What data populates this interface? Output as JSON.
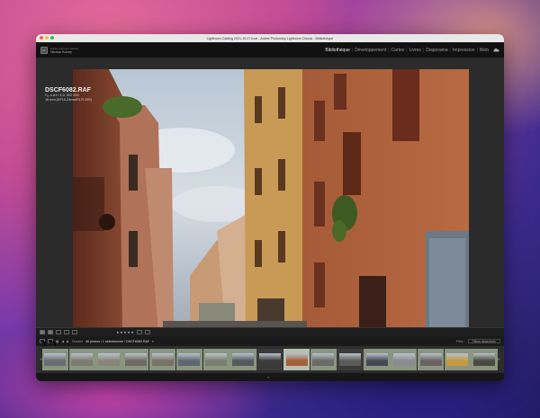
{
  "window": {
    "title": "Lightroom Catalog 2021-10-27.lrcat - Adobe Photoshop Lightroom Classic - Bibliothèque"
  },
  "brand": {
    "top": "Adobe Lightroom Classic",
    "user": "Nicolas Hoizey",
    "logo": "Lr"
  },
  "modules": [
    {
      "label": "Bibliothèque",
      "active": true
    },
    {
      "label": "Développement",
      "active": false
    },
    {
      "label": "Cartes",
      "active": false
    },
    {
      "label": "Livres",
      "active": false
    },
    {
      "label": "Diaporama",
      "active": false
    },
    {
      "label": "Impression",
      "active": false
    },
    {
      "label": "Web",
      "active": false
    }
  ],
  "photo_info": {
    "filename": "DSCF6082.RAF",
    "exposure": "¹⁄₆₀ s à f / 4,0, ISO 200",
    "lens": "16 mm (XF10-24mmF4 R OIS)"
  },
  "toolbar": {
    "stars": "★★★★★"
  },
  "filmnav": {
    "page_left": "1",
    "page_right": "2",
    "source": "Dossier",
    "summary": "46 photos / 1 sélectionnée / DSCF6082.RAF",
    "filter_label": "Filtre :",
    "filter_value": "Filtres désactivés"
  },
  "filmstrip": {
    "thumbs": [
      {
        "num": "1"
      },
      {
        "num": "2"
      },
      {
        "num": "3"
      },
      {
        "num": "4"
      },
      {
        "num": "5"
      },
      {
        "num": "6"
      },
      {
        "num": "7"
      },
      {
        "num": "8"
      },
      {
        "num": "9"
      },
      {
        "num": "10"
      },
      {
        "num": "11"
      },
      {
        "num": "12"
      },
      {
        "num": "13"
      },
      {
        "num": "14"
      },
      {
        "num": "15"
      },
      {
        "num": "16"
      },
      {
        "num": "17"
      }
    ]
  },
  "colors": {
    "accent": "#b7bfae",
    "panel": "#2b2b2b"
  }
}
